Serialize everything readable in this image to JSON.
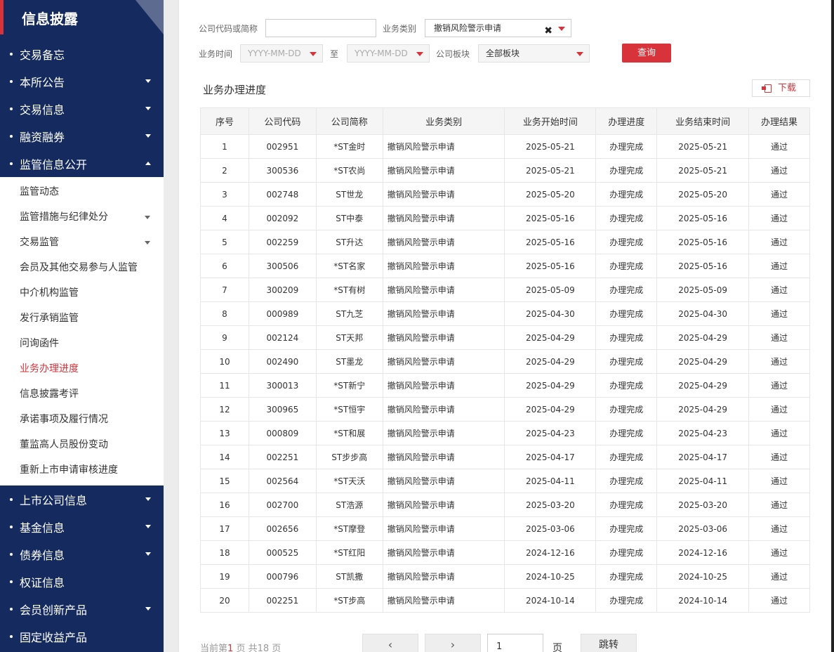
{
  "sidebar": {
    "title": "信息披露",
    "items": [
      {
        "label": "交易备忘",
        "caret": ""
      },
      {
        "label": "本所公告",
        "caret": "down"
      },
      {
        "label": "交易信息",
        "caret": "down"
      },
      {
        "label": "融资融券",
        "caret": "down"
      },
      {
        "label": "监管信息公开",
        "caret": "up"
      }
    ],
    "sub_items": [
      {
        "label": "监管动态",
        "caret": false,
        "active": false
      },
      {
        "label": "监管措施与纪律处分",
        "caret": true,
        "active": false
      },
      {
        "label": "交易监管",
        "caret": true,
        "active": false
      },
      {
        "label": "会员及其他交易参与人监管",
        "caret": false,
        "active": false
      },
      {
        "label": "中介机构监管",
        "caret": false,
        "active": false
      },
      {
        "label": "发行承销监管",
        "caret": false,
        "active": false
      },
      {
        "label": "问询函件",
        "caret": false,
        "active": false
      },
      {
        "label": "业务办理进度",
        "caret": false,
        "active": true
      },
      {
        "label": "信息披露考评",
        "caret": false,
        "active": false
      },
      {
        "label": "承诺事项及履行情况",
        "caret": false,
        "active": false
      },
      {
        "label": "董监高人员股份变动",
        "caret": false,
        "active": false
      },
      {
        "label": "重新上市申请审核进度",
        "caret": false,
        "active": false
      }
    ],
    "items_after": [
      {
        "label": "上市公司信息",
        "caret": "down"
      },
      {
        "label": "基金信息",
        "caret": "down"
      },
      {
        "label": "债券信息",
        "caret": "down"
      },
      {
        "label": "权证信息",
        "caret": ""
      },
      {
        "label": "会员创新产品",
        "caret": "down"
      },
      {
        "label": "固定收益产品",
        "caret": ""
      }
    ]
  },
  "filters": {
    "company_label": "公司代码或简称",
    "company_value": "",
    "type_label": "业务类别",
    "type_value": "撤销风险警示申请",
    "clear_glyph": "✖",
    "time_label": "业务时间",
    "date_from_placeholder": "YYYY-MM-DD",
    "to_label": "至",
    "date_to_placeholder": "YYYY-MM-DD",
    "board_label": "公司板块",
    "board_value": "全部板块",
    "query_label": "查询"
  },
  "section": {
    "title": "业务办理进度",
    "download_label": "下载"
  },
  "table": {
    "headers": [
      "序号",
      "公司代码",
      "公司简称",
      "业务类别",
      "业务开始时间",
      "办理进度",
      "业务结束时间",
      "办理结果"
    ],
    "rows": [
      [
        "1",
        "002951",
        "*ST金时",
        "撤销风险警示申请",
        "2025-05-21",
        "办理完成",
        "2025-05-21",
        "通过"
      ],
      [
        "2",
        "300536",
        "*ST农尚",
        "撤销风险警示申请",
        "2025-05-21",
        "办理完成",
        "2025-05-21",
        "通过"
      ],
      [
        "3",
        "002748",
        "ST世龙",
        "撤销风险警示申请",
        "2025-05-20",
        "办理完成",
        "2025-05-20",
        "通过"
      ],
      [
        "4",
        "002092",
        "ST中泰",
        "撤销风险警示申请",
        "2025-05-16",
        "办理完成",
        "2025-05-16",
        "通过"
      ],
      [
        "5",
        "002259",
        "ST升达",
        "撤销风险警示申请",
        "2025-05-16",
        "办理完成",
        "2025-05-16",
        "通过"
      ],
      [
        "6",
        "300506",
        "*ST名家",
        "撤销风险警示申请",
        "2025-05-16",
        "办理完成",
        "2025-05-16",
        "通过"
      ],
      [
        "7",
        "300209",
        "*ST有树",
        "撤销风险警示申请",
        "2025-05-09",
        "办理完成",
        "2025-05-09",
        "通过"
      ],
      [
        "8",
        "000989",
        "ST九芝",
        "撤销风险警示申请",
        "2025-04-30",
        "办理完成",
        "2025-04-30",
        "通过"
      ],
      [
        "9",
        "002124",
        "ST天邦",
        "撤销风险警示申请",
        "2025-04-29",
        "办理完成",
        "2025-04-29",
        "通过"
      ],
      [
        "10",
        "002490",
        "ST墨龙",
        "撤销风险警示申请",
        "2025-04-29",
        "办理完成",
        "2025-04-29",
        "通过"
      ],
      [
        "11",
        "300013",
        "*ST新宁",
        "撤销风险警示申请",
        "2025-04-29",
        "办理完成",
        "2025-04-29",
        "通过"
      ],
      [
        "12",
        "300965",
        "*ST恒宇",
        "撤销风险警示申请",
        "2025-04-29",
        "办理完成",
        "2025-04-29",
        "通过"
      ],
      [
        "13",
        "000809",
        "*ST和展",
        "撤销风险警示申请",
        "2025-04-23",
        "办理完成",
        "2025-04-23",
        "通过"
      ],
      [
        "14",
        "002251",
        "ST步步高",
        "撤销风险警示申请",
        "2025-04-17",
        "办理完成",
        "2025-04-17",
        "通过"
      ],
      [
        "15",
        "002564",
        "*ST天沃",
        "撤销风险警示申请",
        "2025-04-11",
        "办理完成",
        "2025-04-11",
        "通过"
      ],
      [
        "16",
        "002700",
        "ST浩源",
        "撤销风险警示申请",
        "2025-03-20",
        "办理完成",
        "2025-03-20",
        "通过"
      ],
      [
        "17",
        "002656",
        "*ST摩登",
        "撤销风险警示申请",
        "2025-03-06",
        "办理完成",
        "2025-03-06",
        "通过"
      ],
      [
        "18",
        "000525",
        "*ST红阳",
        "撤销风险警示申请",
        "2024-12-16",
        "办理完成",
        "2024-12-16",
        "通过"
      ],
      [
        "19",
        "000796",
        "ST凯撒",
        "撤销风险警示申请",
        "2024-10-25",
        "办理完成",
        "2024-10-25",
        "通过"
      ],
      [
        "20",
        "002251",
        "*ST步高",
        "撤销风险警示申请",
        "2024-10-14",
        "办理完成",
        "2024-10-14",
        "通过"
      ]
    ]
  },
  "pager": {
    "info_prefix": "当前第",
    "current_page": "1",
    "info_mid": "页 共",
    "total_pages": "18",
    "info_suffix": "页",
    "prev_glyph": "‹",
    "next_glyph": "›",
    "page_input_value": "1",
    "page_unit": "页",
    "jump_label": "跳转"
  },
  "colors": {
    "sidebar_bg": "#152a5e",
    "accent_red": "#d8333a"
  }
}
